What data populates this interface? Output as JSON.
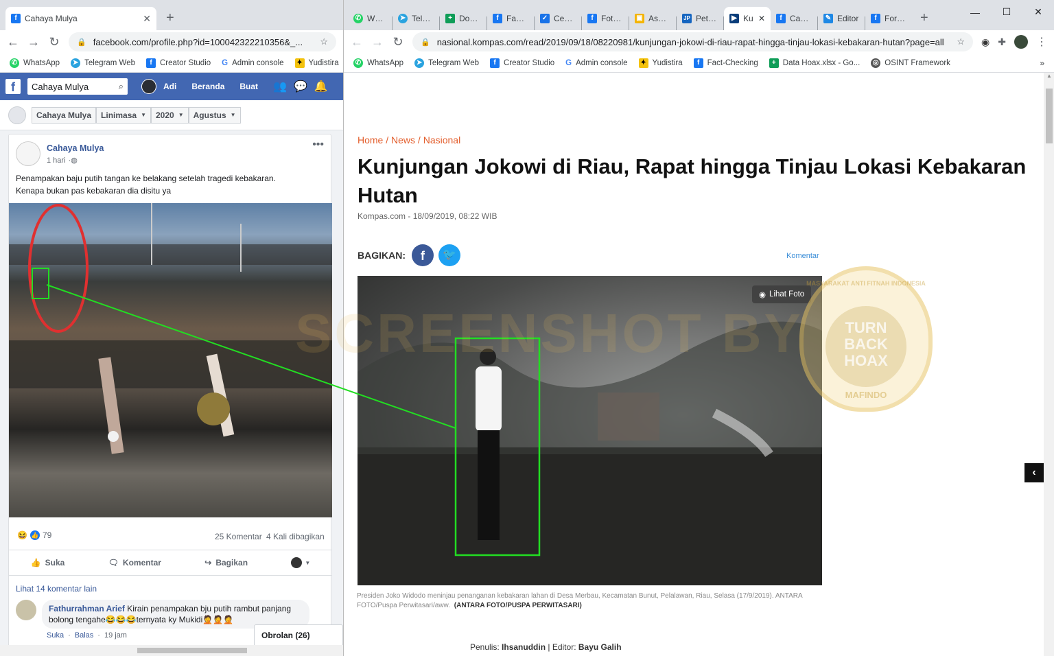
{
  "left_window": {
    "tab": {
      "title": "Cahaya Mulya",
      "favicon": "f"
    },
    "url": "facebook.com/profile.php?id=100042322210356&_...",
    "bookmarks": [
      {
        "label": "WhatsApp",
        "icon": "whatsapp-icon"
      },
      {
        "label": "Telegram Web",
        "icon": "telegram-icon"
      },
      {
        "label": "Creator Studio",
        "icon": "facebook-icon"
      },
      {
        "label": "Admin console",
        "icon": "google-icon"
      },
      {
        "label": "Yudistira",
        "icon": "bookmark-icon"
      }
    ]
  },
  "facebook": {
    "search_value": "Cahaya Mulya",
    "nav": {
      "user": "Adi",
      "home": "Beranda",
      "create": "Buat"
    },
    "filters": {
      "profile": "Cahaya Mulya",
      "view": "Linimasa",
      "year": "2020",
      "month": "Agustus"
    },
    "post": {
      "author": "Cahaya Mulya",
      "time": "1 hari",
      "text_line1": "Penampakan baju putih tangan ke belakang setelah tragedi kebakaran.",
      "text_line2": "Kenapa bukan pas kebakaran dia disitu ya",
      "reaction_count": "79",
      "comments": "25 Komentar",
      "shares": "4 Kali dibagikan",
      "like": "Suka",
      "comment": "Komentar",
      "share": "Bagikan",
      "more_comments": "Lihat 14 komentar lain",
      "comment_author": "Fathurrahman Arief",
      "comment_text1": "Kirain penampakan bju putih rambut panjang",
      "comment_text2": "bolong tengahe😂😂😂ternyata ky Mukidi🤦🤦🤦",
      "comment_like": "Suka",
      "comment_reply": "Balas",
      "comment_time": "19 jam",
      "chat": "Obrolan (26)"
    }
  },
  "right_window": {
    "tabs": [
      {
        "title": "Whats",
        "icon": "whatsapp-icon"
      },
      {
        "title": "Telegr",
        "icon": "telegram-icon"
      },
      {
        "title": "Dokun",
        "icon": "sheets-icon"
      },
      {
        "title": "Facebo",
        "icon": "facebook-icon"
      },
      {
        "title": "Cek Fa",
        "icon": "check-icon"
      },
      {
        "title": "Foto P",
        "icon": "facebook-icon"
      },
      {
        "title": "Asap P",
        "icon": "image-icon"
      },
      {
        "title": "Petuga",
        "icon": "jp-icon"
      },
      {
        "title": "Ku",
        "icon": "kompas-icon",
        "active": true
      },
      {
        "title": "Cahay",
        "icon": "facebook-icon"
      },
      {
        "title": "Editor",
        "icon": "editor-icon"
      },
      {
        "title": "Forum",
        "icon": "facebook-icon"
      }
    ],
    "url": "nasional.kompas.com/read/2019/09/18/08220981/kunjungan-jokowi-di-riau-rapat-hingga-tinjau-lokasi-kebakaran-hutan?page=all",
    "bookmarks": [
      {
        "label": "WhatsApp"
      },
      {
        "label": "Telegram Web"
      },
      {
        "label": "Creator Studio"
      },
      {
        "label": "Admin console"
      },
      {
        "label": "Yudistira"
      },
      {
        "label": "Fact-Checking"
      },
      {
        "label": "Data Hoax.xlsx - Go..."
      },
      {
        "label": "OSINT Framework"
      }
    ]
  },
  "article": {
    "breadcrumb": {
      "home": "Home",
      "news": "News",
      "section": "Nasional"
    },
    "title_line1": "Kunjungan Jokowi di Riau, Rapat hingga Tinjau Lokasi Kebakaran",
    "title_line2": "Hutan",
    "meta": "Kompas.com - 18/09/2019, 08:22 WIB",
    "share_label": "BAGIKAN:",
    "comment_link": "Komentar",
    "photo_button": "Lihat Foto",
    "caption": "Presiden Joko Widodo meninjau penanganan kebakaran lahan di Desa Merbau, Kecamatan Bunut, Pelalawan, Riau, Selasa (17/9/2019). ANTARA FOTO/Puspa Perwitasari/aww.",
    "caption_credit": "(ANTARA FOTO/PUSPA PERWITASARI)",
    "writer_label": "Penulis:",
    "writer": "Ihsanuddin",
    "editor_label": "| Editor:",
    "editor": "Bayu Galih"
  },
  "watermark": {
    "text": "SCREENSHOT BY",
    "seal_top": "TURN",
    "seal_mid": "BACK",
    "seal_bottom": "HOAX",
    "seal_ring_top": "MASYARAKAT ANTI FITNAH INDONESIA",
    "seal_ring_bottom": "MAFINDO"
  },
  "colors": {
    "facebook_blue": "#4267b2",
    "kompas_orange": "#e35d2b",
    "highlight_green": "#22dd22",
    "annotation_red": "#e03030"
  }
}
